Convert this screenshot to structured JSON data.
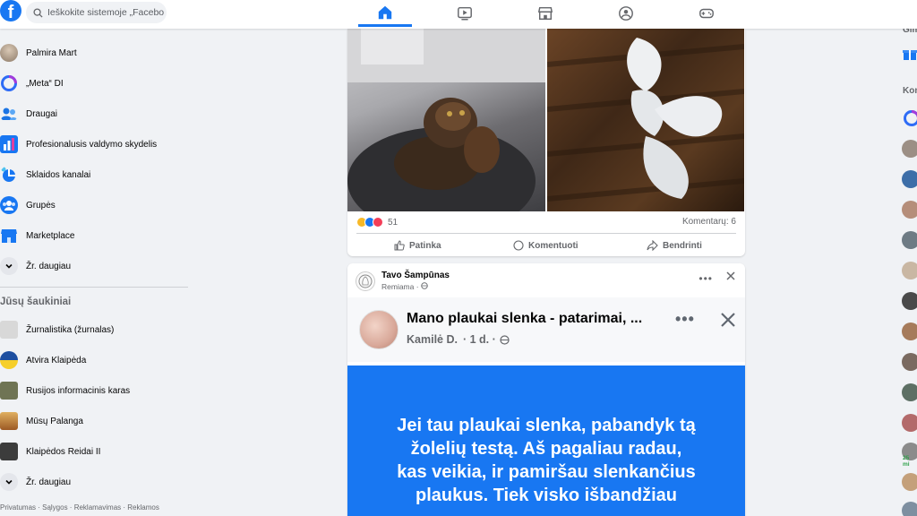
{
  "header": {
    "logo": "f",
    "search_placeholder": "Ieškokite sistemoje „Facebook“",
    "nav": [
      {
        "name": "home",
        "icon": "home-icon",
        "active": true
      },
      {
        "name": "video",
        "icon": "video-icon",
        "active": false
      },
      {
        "name": "marketplace",
        "icon": "store-icon",
        "active": false
      },
      {
        "name": "groups",
        "icon": "groups-icon",
        "active": false
      },
      {
        "name": "gaming",
        "icon": "gaming-icon",
        "active": false
      }
    ]
  },
  "sidebar": {
    "items": [
      {
        "label": "Palmira Mart",
        "icon": "profile-avatar"
      },
      {
        "label": "„Meta“ DI",
        "icon": "meta-ai-icon"
      },
      {
        "label": "Draugai",
        "icon": "friends-icon"
      },
      {
        "label": "Profesionalusis valdymo skydelis",
        "icon": "dashboard-icon"
      },
      {
        "label": "Sklaidos kanalai",
        "icon": "feeds-icon"
      },
      {
        "label": "Grupės",
        "icon": "groups-icon"
      },
      {
        "label": "Marketplace",
        "icon": "marketplace-icon"
      },
      {
        "label": "Žr. daugiau",
        "icon": "chevron-down-icon"
      }
    ],
    "shortcuts_title": "Jūsų šaukiniai",
    "shortcuts": [
      {
        "label": "Žurnalistika (žurnalas)",
        "color": "#d8d8d8"
      },
      {
        "label": "Atvira Klaipėda",
        "color": "#1d4fa0"
      },
      {
        "label": "Rusijos informacinis karas",
        "color": "#6f7454"
      },
      {
        "label": "Mūsų Palanga",
        "color": "#c98a3c"
      },
      {
        "label": "Klaipėdos Reidai II",
        "color": "#3c3c3c"
      }
    ],
    "shortcuts_more": "Žr. daugiau",
    "footer": "Privatumas · Sąlygos · Reklamavimas · Reklamos"
  },
  "post1": {
    "reaction_count": "51",
    "comments": "Komentarų: 6",
    "actions": {
      "like": "Patinka",
      "comment": "Komentuoti",
      "share": "Bendrinti"
    }
  },
  "post2": {
    "author": "Tavo Šampūnas",
    "sponsored": "Remiama ·",
    "inner_title": "Mano plaukai slenka - patarimai, ...",
    "inner_author": "Kamilė D.",
    "inner_time": "· 1 d. ·",
    "body_text": "Jei tau plaukai slenka, pabandyk tą\nžolelių testą. Aš pagaliau radau,\nkas veikia, ir pamiršau slenkančius\nplaukus. Tiek visko išbandžiau"
  },
  "right": {
    "top_label": "Gim",
    "contacts_label": "Kon",
    "time_badge": "25 mi"
  },
  "colors": {
    "brand": "#1877f2",
    "background": "#f0f2f5"
  }
}
